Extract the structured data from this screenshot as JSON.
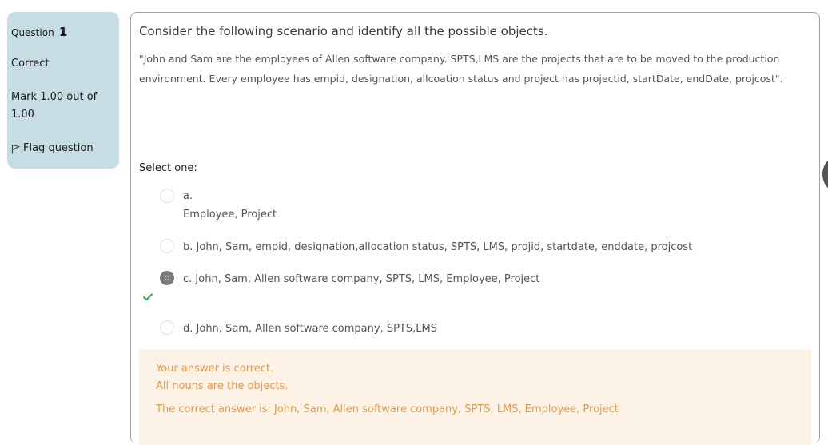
{
  "info": {
    "question_label": "Question",
    "question_number": "1",
    "state": "Correct",
    "grade": "Mark 1.00 out of 1.00",
    "flag_label": "Flag question"
  },
  "question": {
    "prompt": "Consider the following scenario and identify all the possible objects.",
    "scenario": "\"John and Sam are the employees of Allen software company. SPTS,LMS are the projects that are to be moved to the production environment. Every employee has empid, designation, allcoation status and project has projectid, startDate, endDate, projcost\".",
    "select_label": "Select one:",
    "options": [
      {
        "letter": "a.",
        "text": "Employee, Project",
        "checked": false
      },
      {
        "letter": "b.",
        "text": "John, Sam, empid, designation,allocation status, SPTS, LMS, projid, startdate, enddate, projcost",
        "checked": false
      },
      {
        "letter": "c.",
        "text": "John, Sam, Allen software company, SPTS, LMS, Employee, Project",
        "checked": true
      },
      {
        "letter": "d.",
        "text": "John, Sam, Allen software company, SPTS,LMS",
        "checked": false
      }
    ]
  },
  "feedback": {
    "line1": "Your answer is correct.",
    "line2": "All nouns are the objects.",
    "correct_answer": "The correct answer is: John, Sam, Allen software company, SPTS, LMS, Employee, Project"
  },
  "colors": {
    "info_bg": "#c5dde3",
    "feedback_bg": "#fdf2e6",
    "feedback_text": "#e59b4c",
    "correct_check": "#3aa55c"
  },
  "icons": {
    "flag": "flag-icon",
    "correct": "check-icon"
  }
}
